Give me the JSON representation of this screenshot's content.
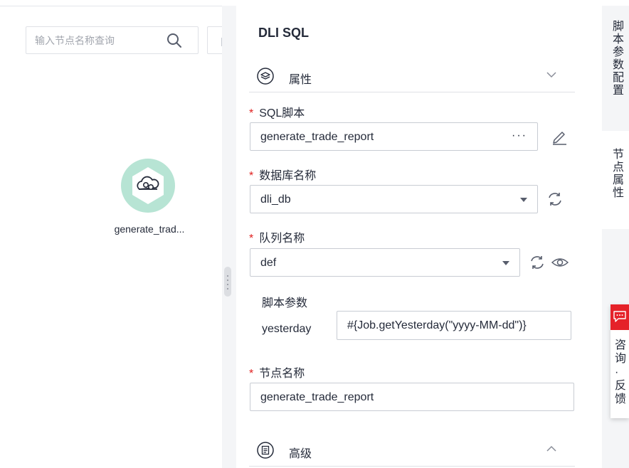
{
  "canvas": {
    "search": {
      "placeholder": "输入节点名称查询",
      "value": ""
    },
    "node": {
      "label": "generate_trad...",
      "icon": "cloud-sql-icon",
      "ring_color": "#b7e4d4"
    }
  },
  "panel": {
    "title": "DLI SQL",
    "properties_section": {
      "label": "属性",
      "icon": "layers-icon",
      "expanded": true
    },
    "sql_script": {
      "label": "SQL脚本",
      "value": "generate_trade_report",
      "more_label": "···"
    },
    "database": {
      "label": "数据库名称",
      "value": "dli_db"
    },
    "queue": {
      "label": "队列名称",
      "value": "def"
    },
    "script_params": {
      "title": "脚本参数",
      "items": [
        {
          "key": "yesterday",
          "value": "#{Job.getYesterday(\"yyyy-MM-dd\")}"
        }
      ]
    },
    "node_name": {
      "label": "节点名称",
      "value": "generate_trade_report"
    },
    "advanced_section": {
      "label": "高级",
      "icon": "list-doc-icon",
      "expanded": false
    },
    "required_mark": "*"
  },
  "right_tabs": [
    {
      "label": "脚本参数配置",
      "active": true
    },
    {
      "label": "节点属性",
      "active": false
    }
  ],
  "feedback": {
    "label": "咨询·反馈",
    "chars": [
      "咨",
      "询",
      "·",
      "反",
      "馈"
    ],
    "color": "#e52229"
  },
  "colors": {
    "accent": "#5e7ce0",
    "required": "#e0201f",
    "node_ring": "#b7e4d4"
  }
}
